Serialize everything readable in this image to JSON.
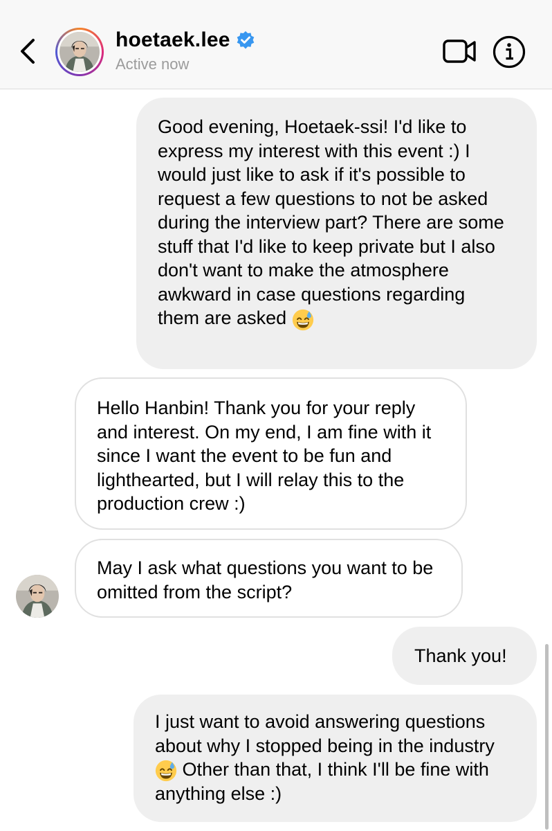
{
  "header": {
    "username": "hoetaek.lee",
    "status": "Active now",
    "verified": true,
    "icons": {
      "back": "chevron-left-icon",
      "verified": "verified-badge-icon",
      "video": "video-camera-icon",
      "info": "info-icon"
    }
  },
  "messages": [
    {
      "direction": "sent",
      "text": "Good evening, Hoetaek-ssi! I'd like to express my interest with this event :) I would just like to ask if it's possible to request a few questions to not be asked during the interview part? There are some stuff that I'd like to keep private but I also don't want to make the atmosphere awkward in case questions regarding them are asked",
      "emoji": "grinning-sweat"
    },
    {
      "direction": "received",
      "text": "Hello Hanbin! Thank you for your reply and interest. On my end, I am fine with it since I want the event to be fun and lighthearted, but I will relay this to the production crew :)"
    },
    {
      "direction": "received",
      "text": "May I ask what questions you want to be omitted from the script?"
    },
    {
      "direction": "sent",
      "text": "Thank you!"
    },
    {
      "direction": "sent",
      "text_before": "I just want to avoid answering questions about why I stopped being in the industry",
      "emoji": "grinning-sweat",
      "text_after": "Other than that, I think I'll be fine with anything else :)"
    }
  ],
  "colors": {
    "sent_bubble": "#efefef",
    "received_border": "#e0e0e0",
    "verified": "#3897f0",
    "status_text": "#9b9b9b",
    "header_bg": "#f8f8f8"
  }
}
